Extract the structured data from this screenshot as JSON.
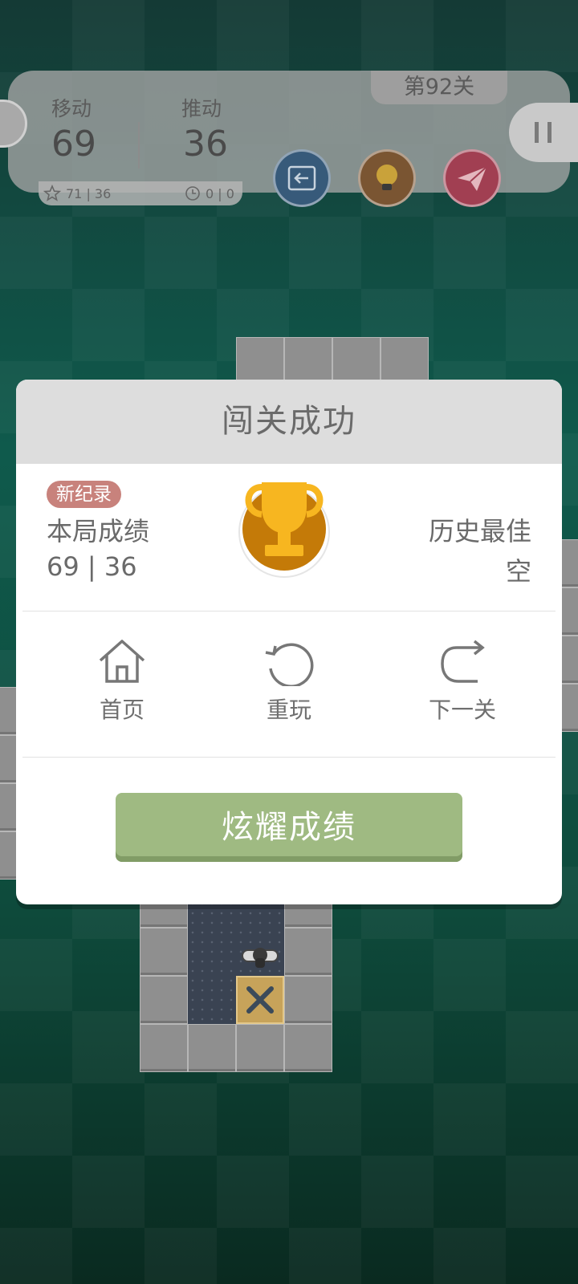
{
  "hud": {
    "moves_label": "移动",
    "moves_value": "69",
    "pushes_label": "推动",
    "pushes_value": "36",
    "star_record": "71 | 36",
    "time_record": "0 | 0",
    "level": "第92关",
    "buttons": [
      "undo-icon",
      "hint-bulb-icon",
      "share-plane-icon",
      "pause-icon"
    ]
  },
  "dialog": {
    "title": "闯关成功",
    "new_record_badge": "新纪录",
    "current_label": "本局成绩",
    "current_value": "69 | 36",
    "best_label": "历史最佳",
    "best_value": "空",
    "actions": [
      {
        "label": "首页",
        "icon": "home-icon"
      },
      {
        "label": "重玩",
        "icon": "replay-icon"
      },
      {
        "label": "下一关",
        "icon": "next-level-icon"
      }
    ],
    "share_button": "炫耀成绩",
    "trophy_colors": {
      "cup": "#f7b620",
      "disc": "#c47a08"
    }
  }
}
